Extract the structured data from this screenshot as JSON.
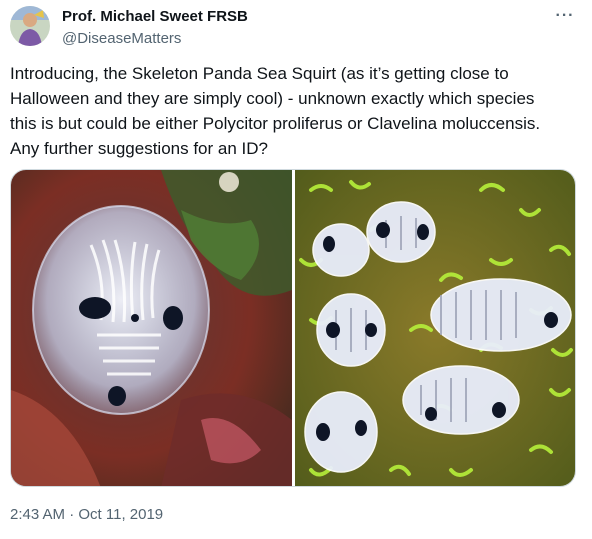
{
  "author": {
    "name": "Prof. Michael Sweet FRSB",
    "handle": "@DiseaseMatters"
  },
  "tweet": {
    "text_lines": [
      "Introducing, the Skeleton Panda Sea Squirt (as it’s getting close to",
      "Halloween and they are simply cool) - unknown exactly which species",
      "this is but could be either Polycitor proliferus or Clavelina moluccensis.",
      "Any further suggestions for an ID?"
    ],
    "timestamp": "2:43 AM · Oct 11, 2019"
  },
  "more_label": "···",
  "colors": {
    "text": "#0f1419",
    "secondary": "#536471",
    "border": "#cfd9de"
  },
  "icons": {
    "more": "more-horizontal-icon"
  }
}
